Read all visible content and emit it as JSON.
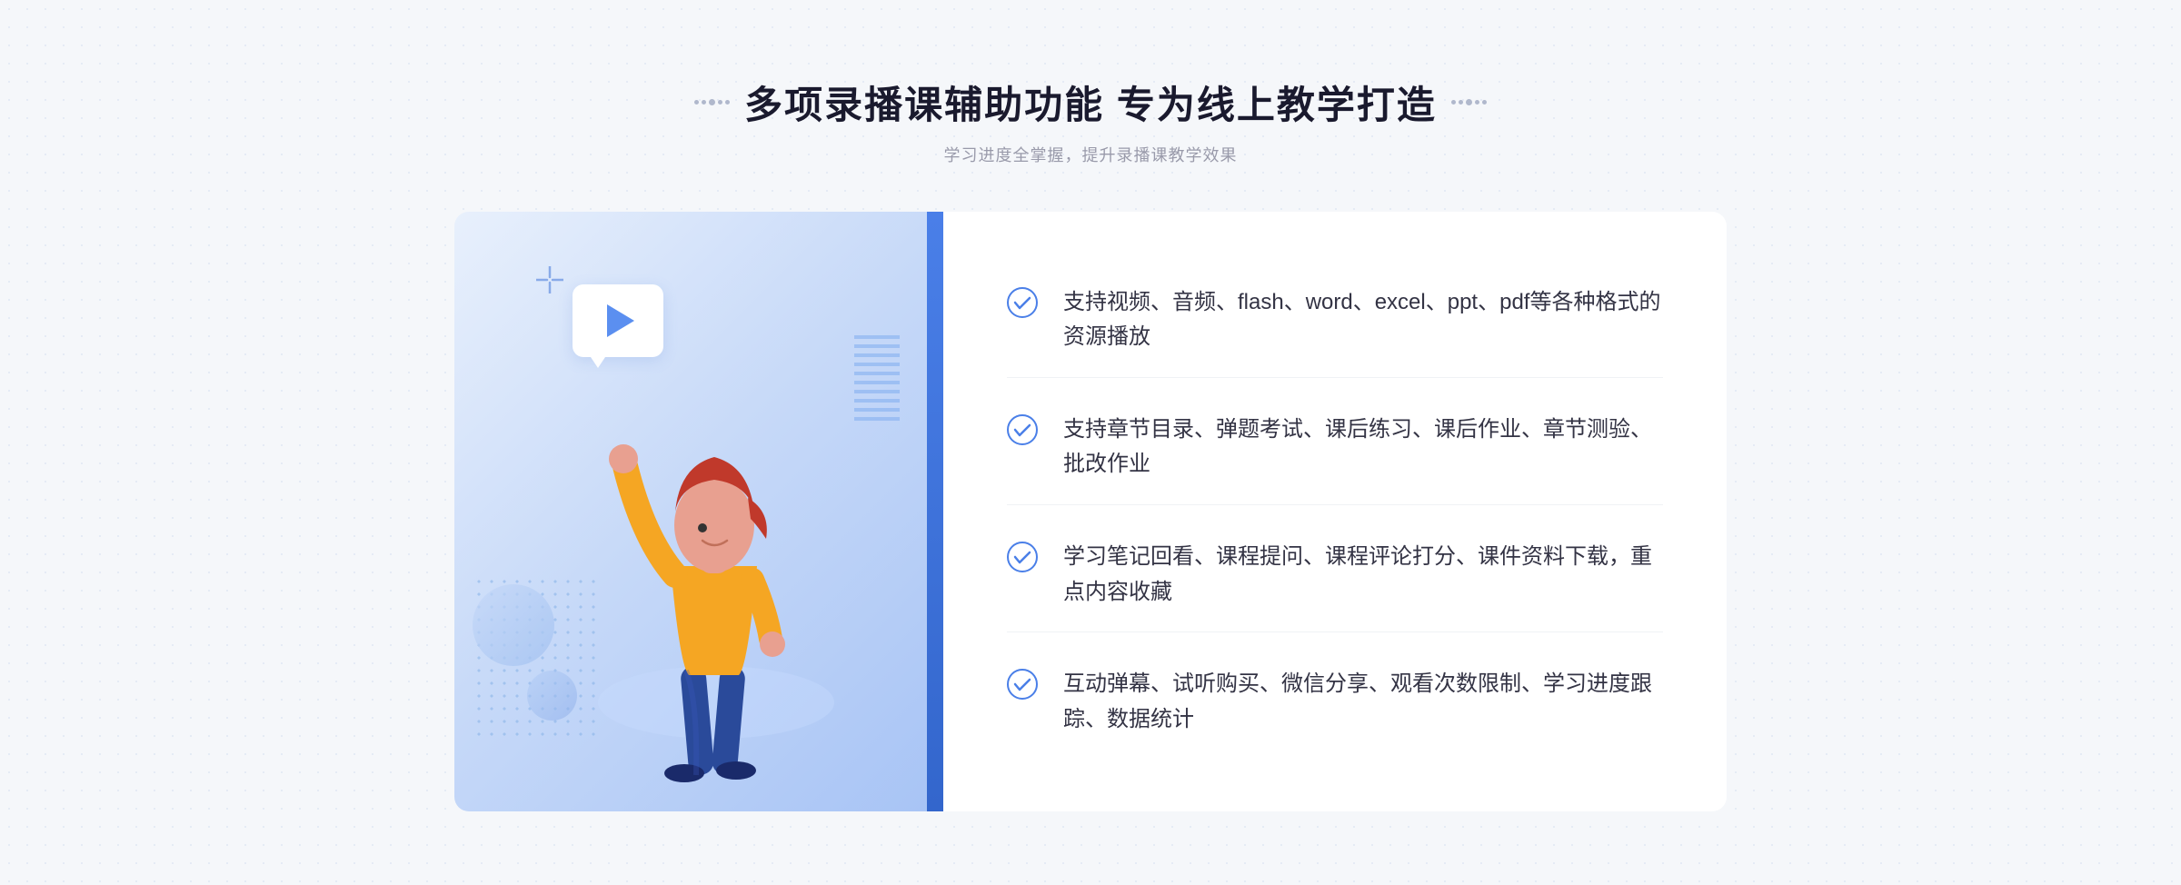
{
  "header": {
    "title": "多项录播课辅助功能 专为线上教学打造",
    "subtitle": "学习进度全掌握，提升录播课教学效果",
    "deco_left": "decorative dots left",
    "deco_right": "decorative dots right"
  },
  "features": [
    {
      "id": 1,
      "text": "支持视频、音频、flash、word、excel、ppt、pdf等各种格式的资源播放"
    },
    {
      "id": 2,
      "text": "支持章节目录、弹题考试、课后练习、课后作业、章节测验、批改作业"
    },
    {
      "id": 3,
      "text": "学习笔记回看、课程提问、课程评论打分、课件资料下载，重点内容收藏"
    },
    {
      "id": 4,
      "text": "互动弹幕、试听购买、微信分享、观看次数限制、学习进度跟踪、数据统计"
    }
  ],
  "accent_color": "#4a7fe8",
  "side_arrow_label": "»"
}
